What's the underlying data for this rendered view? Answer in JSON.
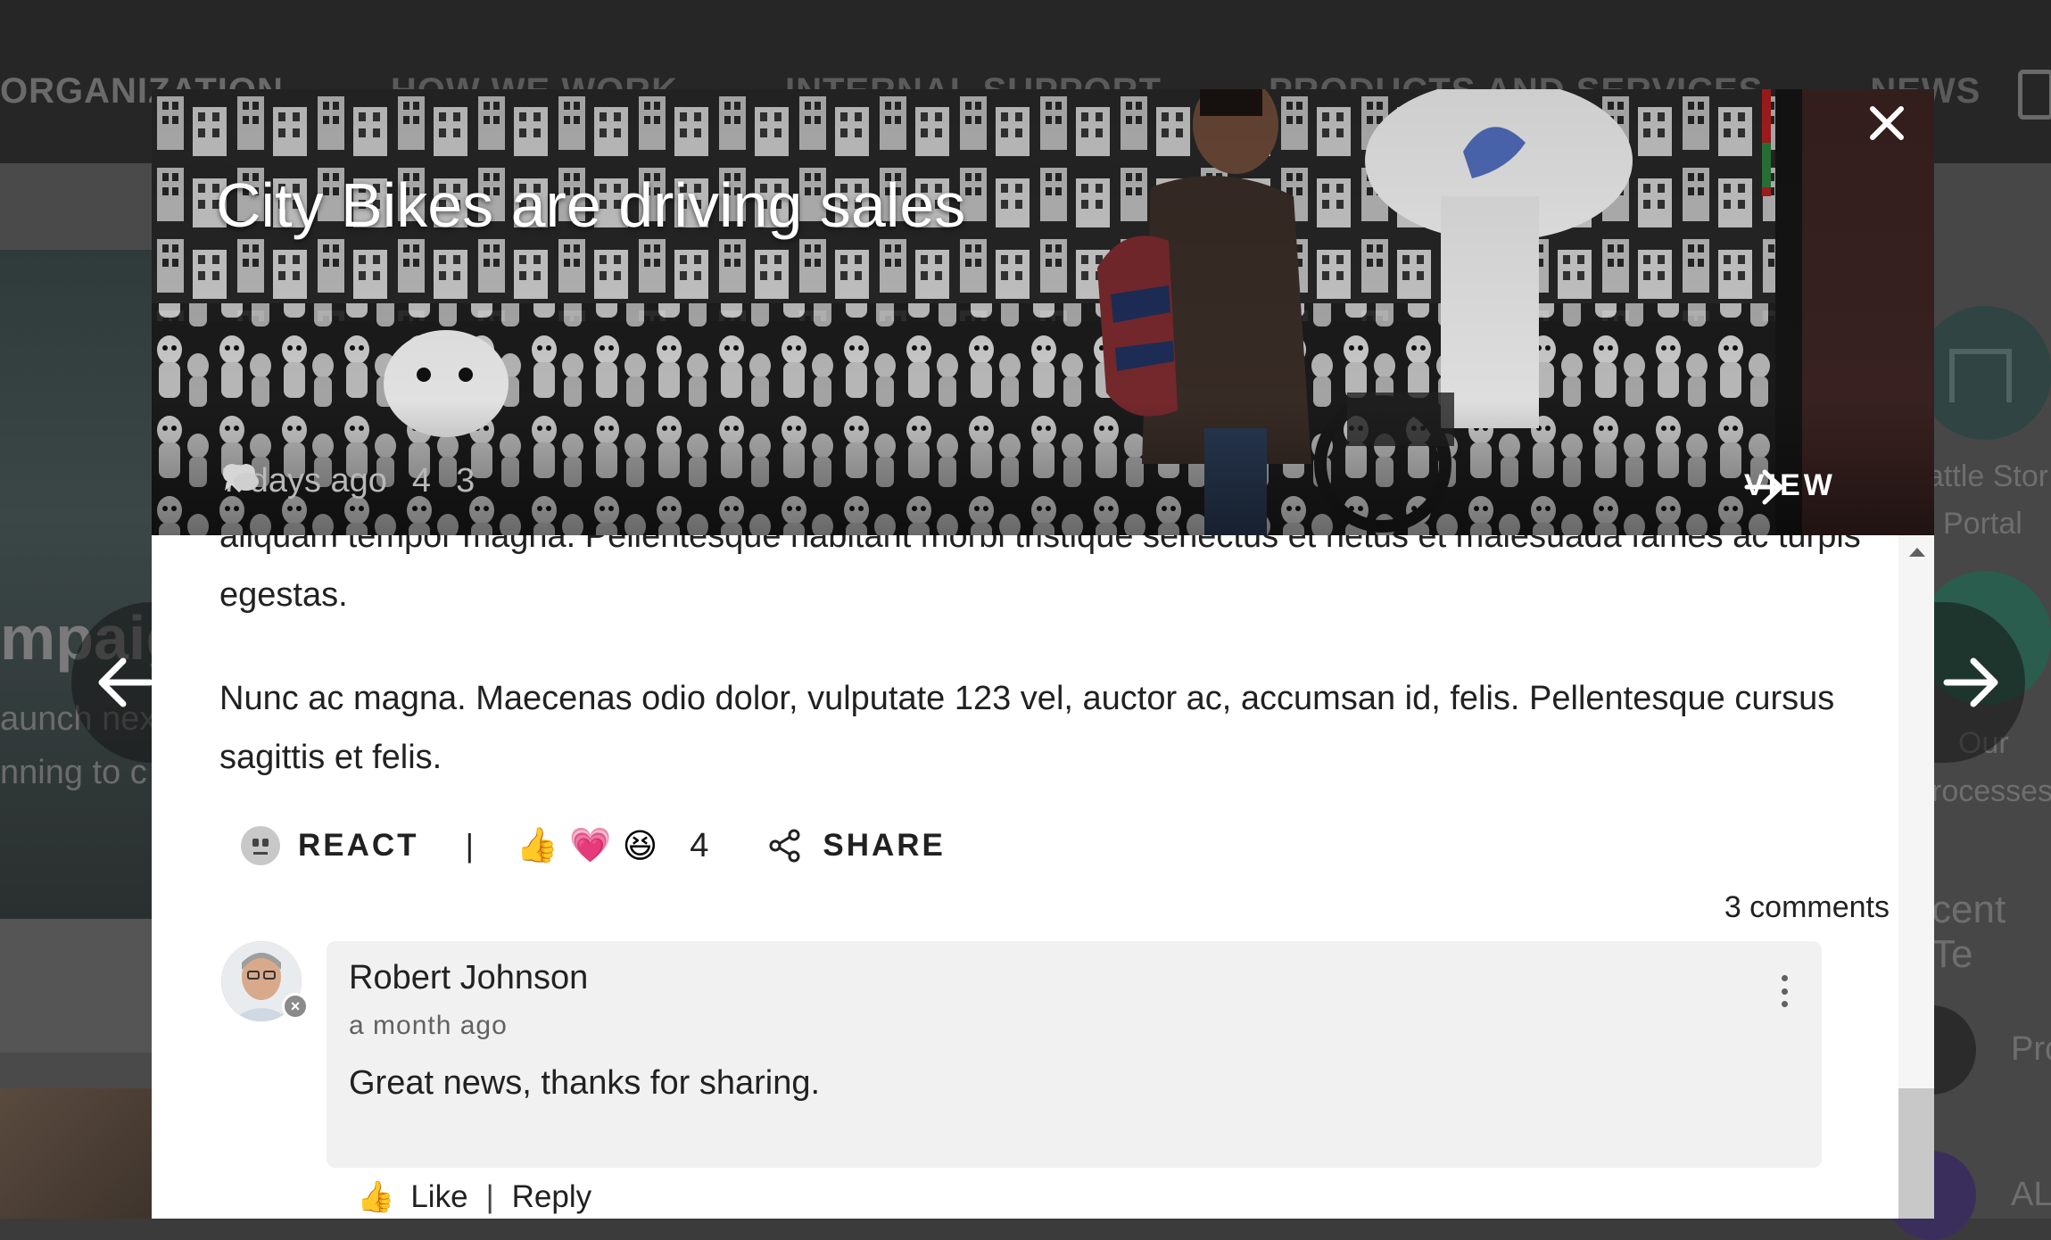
{
  "background": {
    "nav_items": [
      "ORGANIZATION",
      "HOW WE WORK",
      "INTERNAL SUPPORT",
      "PRODUCTS AND SERVICES",
      "NEWS"
    ],
    "hero_title": "mpaig",
    "hero_sub1": "aunch nex",
    "hero_sub2": "nning to c",
    "right_items": [
      {
        "line1": "attle Stor",
        "line2": "Portal"
      },
      {
        "line1": "Our",
        "line2": "rocesses"
      }
    ],
    "recent_heading": "cent Te",
    "recent_rows": [
      "Pro",
      "AL"
    ]
  },
  "modal": {
    "title": "City Bikes are driving sales",
    "close_label": "×",
    "meta": {
      "time": "7 days ago",
      "likes": "4",
      "comments": "3"
    },
    "view_label": "VIEW",
    "paragraph_cut": "aliquam tempor magna. Pellentesque habitant morbi tristique senectus et netus et malesuada fames ac turpis egestas.",
    "paragraph_2": "Nunc ac magna. Maecenas odio dolor, vulputate 123 vel, auctor ac, accumsan id, felis. Pellentesque cursus sagittis et felis.",
    "actions": {
      "react_label": "REACT",
      "separator": "|",
      "reaction_emojis": [
        "👍",
        "💗",
        "😆"
      ],
      "reaction_count": "4",
      "share_label": "SHARE"
    },
    "comments_count": "3 comments",
    "comment": {
      "author": "Robert Johnson",
      "time": "a month ago",
      "text": "Great news, thanks for sharing.",
      "like_label": "Like",
      "separator": "|",
      "reply_label": "Reply"
    }
  },
  "icons": {
    "close": "close-icon",
    "prev": "arrow-left-icon",
    "next": "arrow-right-icon",
    "heart": "heart-icon",
    "comment": "comment-bubble-icon",
    "share": "share-icon",
    "menu": "more-vertical-icon"
  },
  "colors": {
    "overlay": "#3b3b3b",
    "modal_bg": "#ffffff",
    "comment_bg": "#f1f1f1",
    "text_primary": "#212121",
    "text_secondary": "#616161"
  }
}
